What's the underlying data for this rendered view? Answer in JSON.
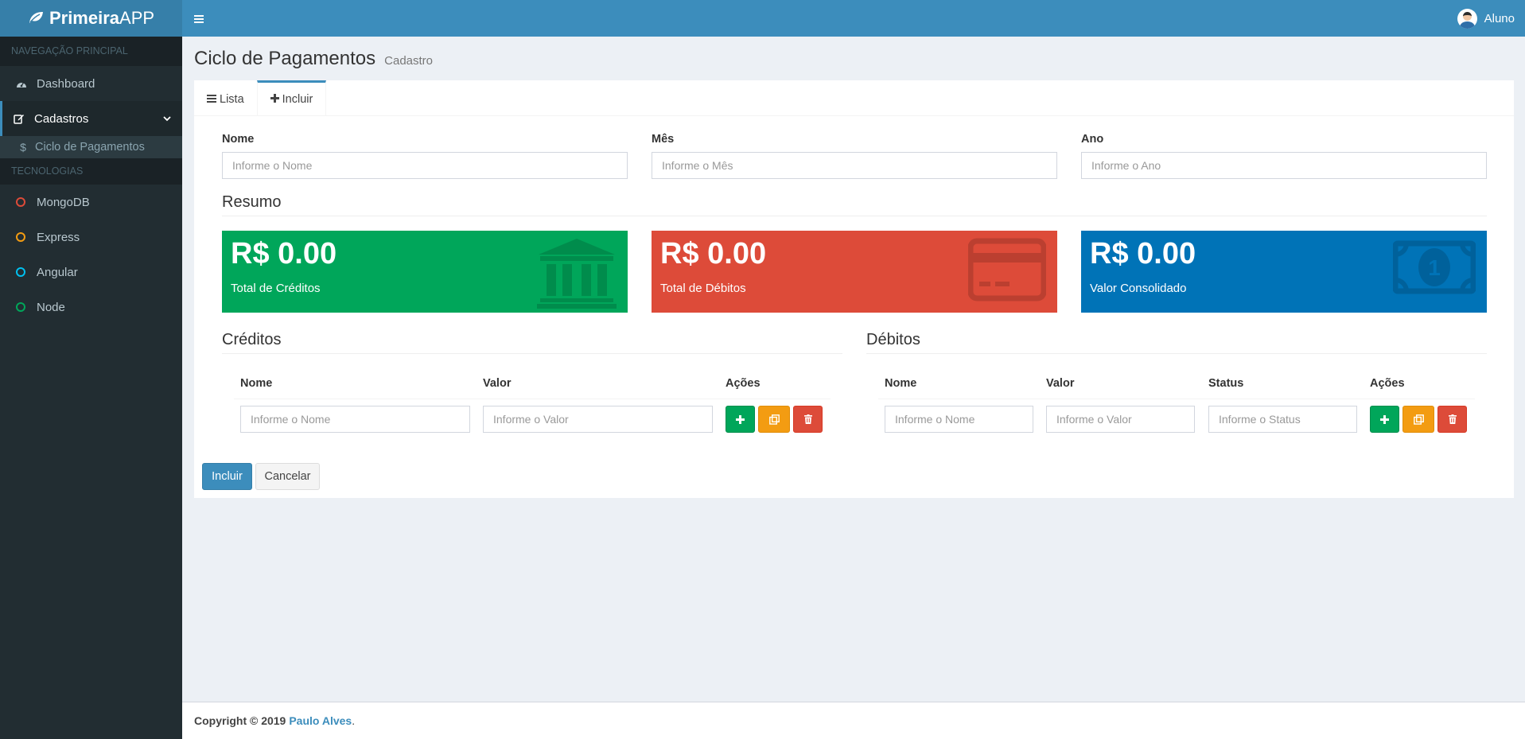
{
  "app": {
    "logo_bold": "Primeira",
    "logo_light": "APP"
  },
  "header": {
    "user_name": "Aluno"
  },
  "sidebar": {
    "section_main": "Navegação Principal",
    "dashboard": "Dashboard",
    "cadastros": "Cadastros",
    "ciclo": "Ciclo de Pagamentos",
    "section_tech": "Tecnologias",
    "tech": [
      {
        "label": "MongoDB",
        "color": "#dd4b39"
      },
      {
        "label": "Express",
        "color": "#f39c12"
      },
      {
        "label": "Angular",
        "color": "#00c0ef"
      },
      {
        "label": "Node",
        "color": "#00a65a"
      }
    ]
  },
  "page": {
    "title": "Ciclo de Pagamentos",
    "subtitle": "Cadastro"
  },
  "tabs": {
    "lista": "Lista",
    "incluir": "Incluir"
  },
  "form": {
    "nome_label": "Nome",
    "nome_placeholder": "Informe o Nome",
    "mes_label": "Mês",
    "mes_placeholder": "Informe o Mês",
    "ano_label": "Ano",
    "ano_placeholder": "Informe o Ano"
  },
  "resumo": {
    "title": "Resumo",
    "creditos_value": "R$ 0.00",
    "creditos_label": "Total de Créditos",
    "debitos_value": "R$ 0.00",
    "debitos_label": "Total de Débitos",
    "consolidado_value": "R$ 0.00",
    "consolidado_label": "Valor Consolidado"
  },
  "creditos": {
    "title": "Créditos",
    "col_nome": "Nome",
    "col_valor": "Valor",
    "col_acoes": "Ações",
    "nome_placeholder": "Informe o Nome",
    "valor_placeholder": "Informe o Valor"
  },
  "debitos": {
    "title": "Débitos",
    "col_nome": "Nome",
    "col_valor": "Valor",
    "col_status": "Status",
    "col_acoes": "Ações",
    "nome_placeholder": "Informe o Nome",
    "valor_placeholder": "Informe o Valor",
    "status_placeholder": "Informe o Status"
  },
  "actions": {
    "incluir": "Incluir",
    "cancelar": "Cancelar"
  },
  "footer": {
    "copyright": "Copyright © 2019",
    "author": "Paulo Alves"
  }
}
